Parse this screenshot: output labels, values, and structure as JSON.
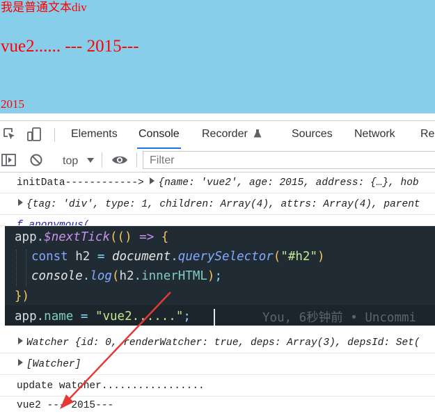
{
  "page": {
    "text_div": "我是普通文本div",
    "h2": "vue2...... --- 2015---",
    "year": "2015"
  },
  "devtools": {
    "tabs": [
      "Elements",
      "Console",
      "Recorder",
      "Sources",
      "Network",
      "Rec"
    ],
    "active_tab": "Console",
    "icons": [
      "inspect-element-icon",
      "device-toolbar-icon",
      "flask-icon"
    ]
  },
  "console_toolbar": {
    "context": "top",
    "filter_placeholder": "Filter",
    "icons": [
      "sidebar-toggle-icon",
      "clear-console-icon",
      "dropdown-arrow-icon",
      "eye-icon"
    ]
  },
  "console_lines": {
    "line1_label": "initData------------> ",
    "line1_obj": "{name: 'vue2', age: 2015, address: {…}, hob",
    "line2_obj": "{tag: 'div', type: 1, children: Array(4), attrs: Array(4), parent",
    "line3_partial": "f anonymous(",
    "line4_partial": "app.name = {...}",
    "line5": "Watcher {id: 0, renderWatcher: true, deps: Array(3), depsId: Set(",
    "line6": "[Watcher]",
    "line7": "update watcher.................",
    "line8": "vue2 --- 2015---"
  },
  "code_overlay": {
    "line1": "app.$nextTick(() => {",
    "line2": "const h2 = document.querySelector(\"#h2\")",
    "line3": "console.log(h2.innerHTML);",
    "line4": "})",
    "line5": "app.name = \"vue2......\";",
    "blame": "You, 6秒钟前 • Uncommi"
  },
  "colors": {
    "page_bg": "#87ceeb",
    "page_text": "#ff0000",
    "overlay_bg": "#212b33",
    "active_tab_underline": "#1a73e8",
    "arrow": "#e53935"
  }
}
